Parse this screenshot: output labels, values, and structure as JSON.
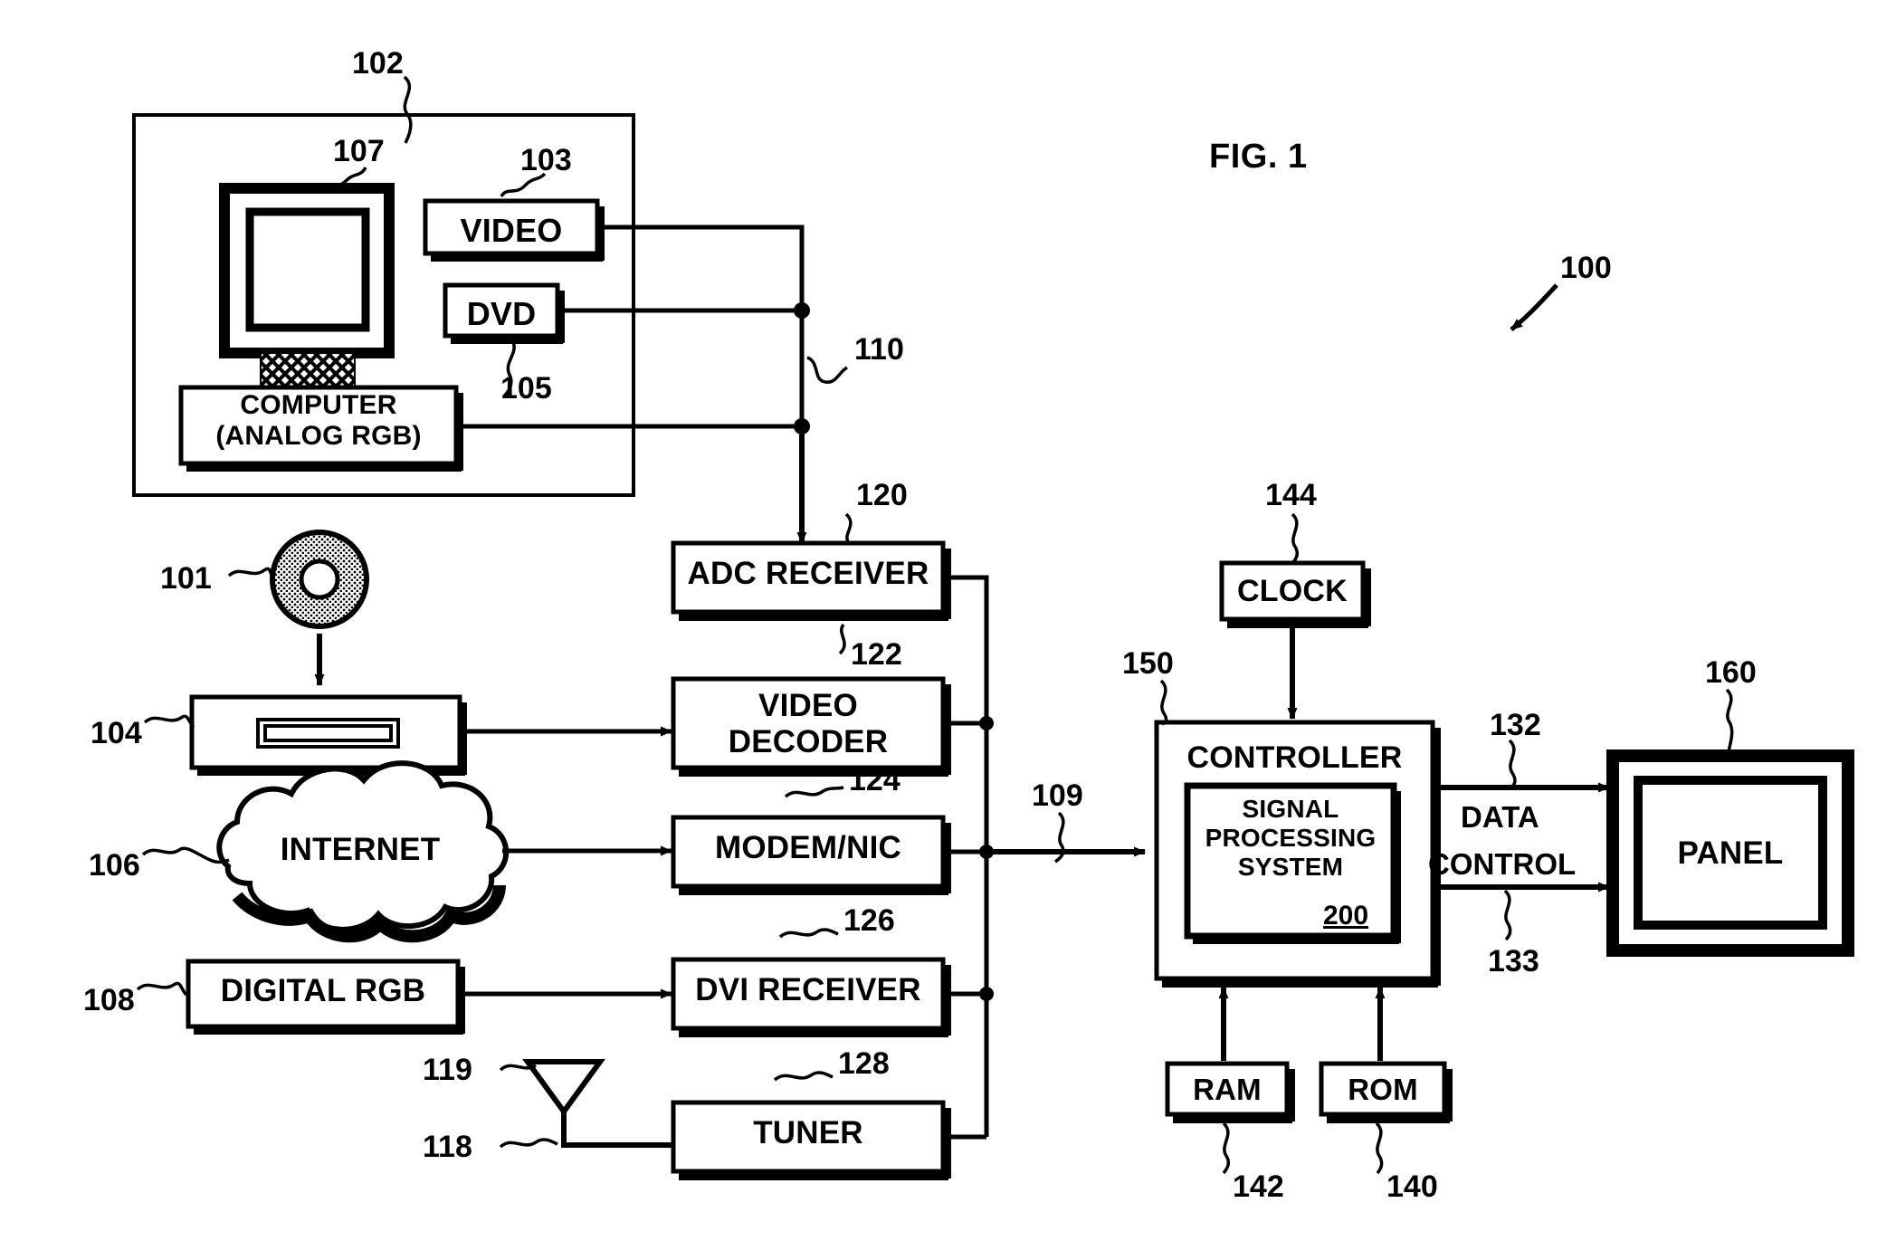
{
  "figure": {
    "title": "FIG. 1",
    "system_ref": "100"
  },
  "source_group": {
    "ref": "102",
    "monitor_ref": "107",
    "computer_label": "COMPUTER\n(ANALOG RGB)",
    "video_label": "VIDEO",
    "video_ref": "103",
    "dvd_label": "DVD",
    "dvd_ref": "105",
    "bus_ref": "110"
  },
  "inputs": [
    {
      "name": "disc",
      "ref": "101",
      "label": ""
    },
    {
      "name": "vcr",
      "ref": "104",
      "label": ""
    },
    {
      "name": "internet",
      "ref": "106",
      "label": "INTERNET"
    },
    {
      "name": "digital-rgb",
      "ref": "108",
      "label": "DIGITAL RGB"
    },
    {
      "name": "antenna",
      "ref": "119",
      "label": ""
    },
    {
      "name": "antenna-feed",
      "ref": "118",
      "label": ""
    }
  ],
  "receivers": [
    {
      "name": "adc-receiver",
      "label": "ADC RECEIVER",
      "ref": "120"
    },
    {
      "name": "video-decoder",
      "label": "VIDEO\nDECODER",
      "ref": "122"
    },
    {
      "name": "modem-nic",
      "label": "MODEM/NIC",
      "ref": "124"
    },
    {
      "name": "dvi-receiver",
      "label": "DVI RECEIVER",
      "ref": "126"
    },
    {
      "name": "tuner",
      "label": "TUNER",
      "ref": "128"
    }
  ],
  "combined_bus": {
    "ref": "109"
  },
  "controller": {
    "label": "CONTROLLER",
    "ref": "150",
    "inner": {
      "label": "SIGNAL\nPROCESSING\nSYSTEM",
      "ref": "200"
    }
  },
  "clock": {
    "label": "CLOCK",
    "ref": "144"
  },
  "memory": [
    {
      "name": "ram",
      "label": "RAM",
      "ref": "142"
    },
    {
      "name": "rom",
      "label": "ROM",
      "ref": "140"
    }
  ],
  "outputs": [
    {
      "name": "data-line",
      "label": "DATA",
      "ref": "132"
    },
    {
      "name": "control-line",
      "label": "CONTROL",
      "ref": "133"
    }
  ],
  "panel": {
    "label": "PANEL",
    "ref": "160"
  },
  "colors": {
    "ink": "#000000",
    "paper": "#ffffff"
  }
}
